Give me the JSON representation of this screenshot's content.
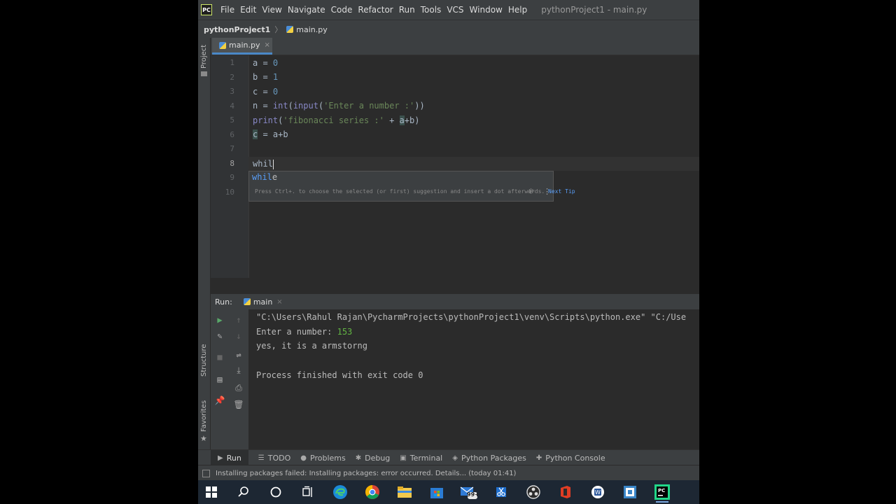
{
  "app_icon_text": "PC",
  "menu": [
    "File",
    "Edit",
    "View",
    "Navigate",
    "Code",
    "Refactor",
    "Run",
    "Tools",
    "VCS",
    "Window",
    "Help"
  ],
  "window_title": "pythonProject1 - main.py",
  "breadcrumb": {
    "project": "pythonProject1",
    "separator": "〉",
    "file": "main.py"
  },
  "left_stripe": {
    "project": "Project",
    "structure": "Structure",
    "favorites": "Favorites"
  },
  "editor_tab": {
    "label": "main.py",
    "close": "×"
  },
  "line_numbers": [
    "1",
    "2",
    "3",
    "4",
    "5",
    "6",
    "7",
    "8",
    "9",
    "10"
  ],
  "code": {
    "l1_var": "a",
    "l1_op": " = ",
    "l1_num": "0",
    "l2_var": "b",
    "l2_op": " = ",
    "l2_num": "1",
    "l3_var": "c",
    "l3_op": " = ",
    "l3_num": "0",
    "l4_pre": "n = ",
    "l4_int": "int",
    "l4_open": "(",
    "l4_input": "input",
    "l4_paren": "(",
    "l4_str": "'Enter a number :'",
    "l4_close": "))",
    "l5_print": "print",
    "l5_open": "(",
    "l5_str": "'fibonacci series :'",
    "l5_plus": " + ",
    "l5_a": "a",
    "l5_rest": "+b)",
    "l6_c": "c",
    "l6_rest": " = a+b",
    "l8_typed": "whil"
  },
  "completion": {
    "match": "whil",
    "rest": "e",
    "hint": "Press Ctrl+. to choose the selected (or first) suggestion and insert a dot afterwards.",
    "next_tip": "Next Tip",
    "spinner": "⁜",
    "menu": "⋮"
  },
  "run_panel": {
    "label": "Run:",
    "tab": "main",
    "tab_close": "×",
    "lines": {
      "cmd": "\"C:\\Users\\Rahul Rajan\\PycharmProjects\\pythonProject1\\venv\\Scripts\\python.exe\" \"C:/Use",
      "prompt": "Enter a number: ",
      "input": "153",
      "result": "yes, it is a armstorng",
      "exit": "Process finished with exit code 0"
    }
  },
  "bottom_tools": [
    {
      "icon": "▶",
      "label": "Run"
    },
    {
      "icon": "☰",
      "label": "TODO"
    },
    {
      "icon": "●",
      "label": "Problems"
    },
    {
      "icon": "✱",
      "label": "Debug"
    },
    {
      "icon": "▣",
      "label": "Terminal"
    },
    {
      "icon": "◈",
      "label": "Python Packages"
    },
    {
      "icon": "✚",
      "label": "Python Console"
    }
  ],
  "status_text": "Installing packages failed: Installing packages: error occurred. Details... (today 01:41)",
  "taskbar_badge": "99+",
  "colors": {
    "keyword": "#cc7832",
    "number": "#6897bb",
    "string": "#6a8759",
    "builtin": "#8888c6",
    "accent": "#4a88c7"
  }
}
